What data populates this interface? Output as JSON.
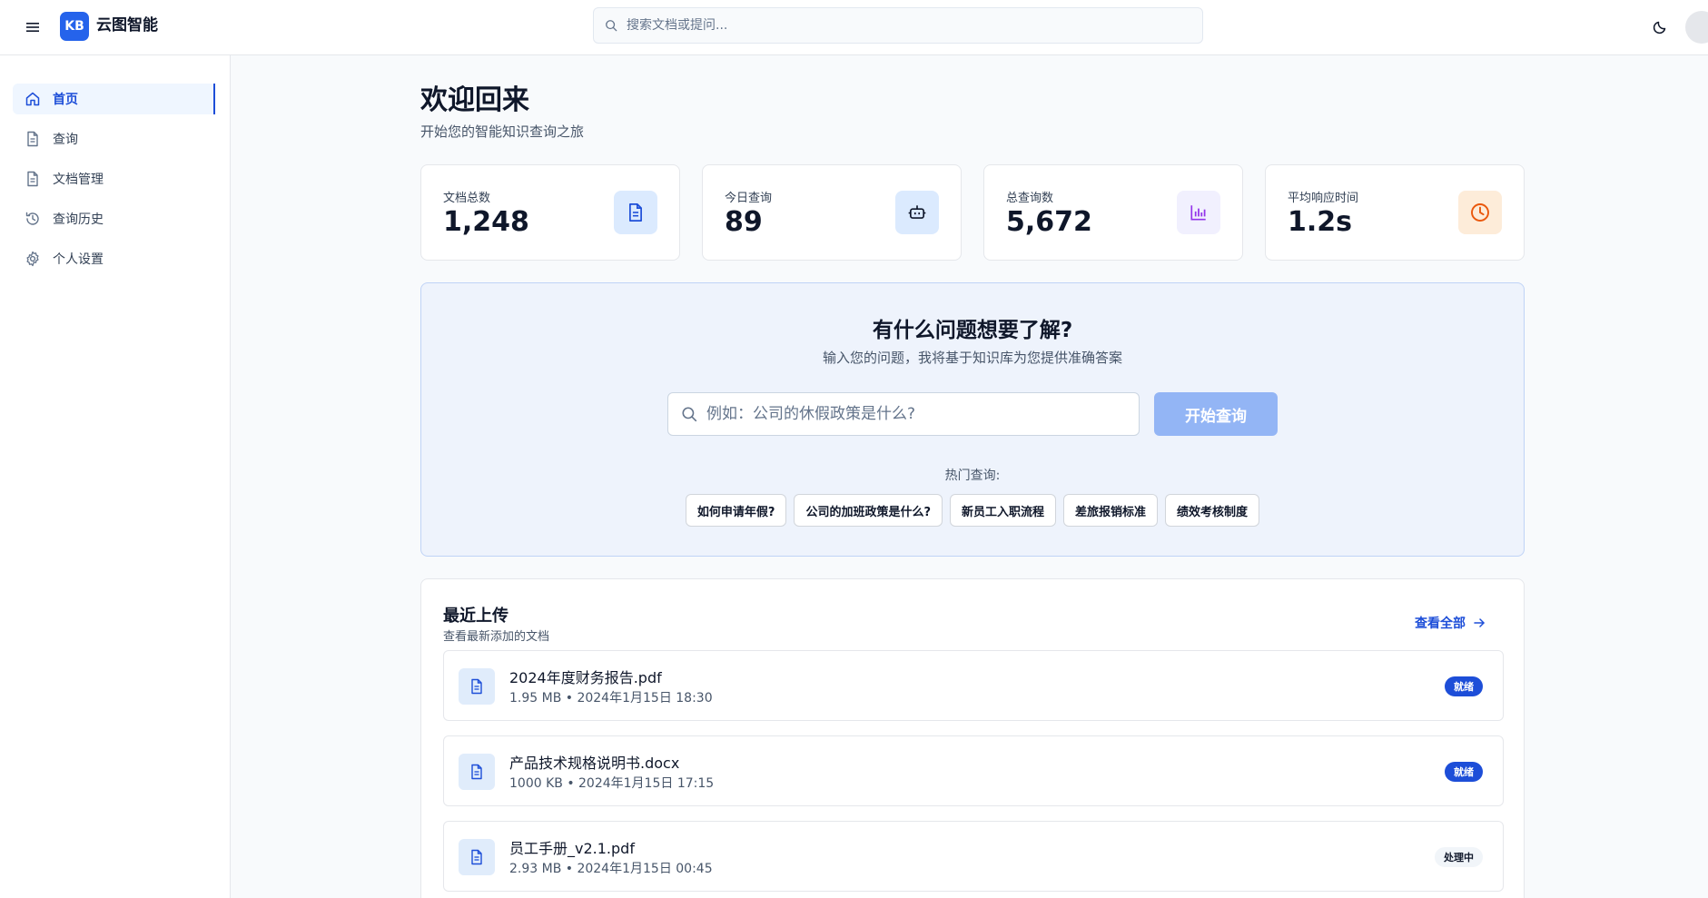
{
  "brand": {
    "logo_text": "KB",
    "name": "云图智能"
  },
  "top_search": {
    "placeholder": "搜索文档或提问..."
  },
  "sidebar": {
    "items": [
      {
        "label": "首页",
        "icon": "home-icon",
        "active": true
      },
      {
        "label": "查询",
        "icon": "document-icon",
        "active": false
      },
      {
        "label": "文档管理",
        "icon": "document-icon",
        "active": false
      },
      {
        "label": "查询历史",
        "icon": "history-icon",
        "active": false
      },
      {
        "label": "个人设置",
        "icon": "gear-icon",
        "active": false
      }
    ]
  },
  "welcome": {
    "title": "欢迎回来",
    "subtitle": "开始您的智能知识查询之旅"
  },
  "stats": [
    {
      "label": "文档总数",
      "value": "1,248",
      "icon": "document-icon",
      "color": "#1d4ed8",
      "bg": "#dbeafe"
    },
    {
      "label": "今日查询",
      "value": "89",
      "icon": "robot-icon",
      "color": "#0f172a",
      "bg": "#dbeafe"
    },
    {
      "label": "总查询数",
      "value": "5,672",
      "icon": "bar-chart-icon",
      "color": "#9333ea",
      "bg": "#f1f0fe"
    },
    {
      "label": "平均响应时间",
      "value": "1.2s",
      "icon": "clock-icon",
      "color": "#ea580c",
      "bg": "#fdecd9"
    }
  ],
  "ask": {
    "title": "有什么问题想要了解?",
    "subtitle": "输入您的问题，我将基于知识库为您提供准确答案",
    "placeholder": "例如：公司的休假政策是什么?",
    "button": "开始查询",
    "hot_label": "热门查询:",
    "hot_queries": [
      "如何申请年假?",
      "公司的加班政策是什么?",
      "新员工入职流程",
      "差旅报销标准",
      "绩效考核制度"
    ]
  },
  "recent": {
    "title": "最近上传",
    "subtitle": "查看最新添加的文档",
    "view_all": "查看全部",
    "files": [
      {
        "name": "2024年度财务报告.pdf",
        "meta": "1.95 MB • 2024年1月15日 18:30",
        "status": "就绪",
        "status_type": "ready"
      },
      {
        "name": "产品技术规格说明书.docx",
        "meta": "1000 KB • 2024年1月15日 17:15",
        "status": "就绪",
        "status_type": "ready"
      },
      {
        "name": "员工手册_v2.1.pdf",
        "meta": "2.93 MB • 2024年1月15日 00:45",
        "status": "处理中",
        "status_type": "processing"
      }
    ]
  }
}
